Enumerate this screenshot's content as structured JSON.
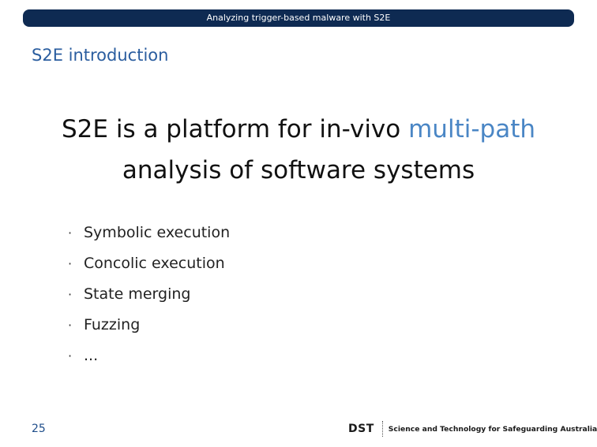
{
  "header": {
    "title": "Analyzing trigger-based malware with S2E"
  },
  "frame": {
    "title": "S2E introduction"
  },
  "headline": {
    "line1_prefix": "S2E is a platform for in-vivo ",
    "line1_accent": "multi-path",
    "line2": "analysis of software systems"
  },
  "bullets": [
    "Symbolic execution",
    "Concolic execution",
    "State merging",
    "Fuzzing",
    "..."
  ],
  "footer": {
    "page_number": "25",
    "logo_mark": "DST",
    "logo_tagline": "Science and Technology for Safeguarding Australia"
  },
  "colors": {
    "header_bar": "#0e2a52",
    "title_blue": "#2a5d9f",
    "accent_blue": "#4a86c5"
  },
  "icons": {
    "bullet": "bullet-dot-icon"
  }
}
